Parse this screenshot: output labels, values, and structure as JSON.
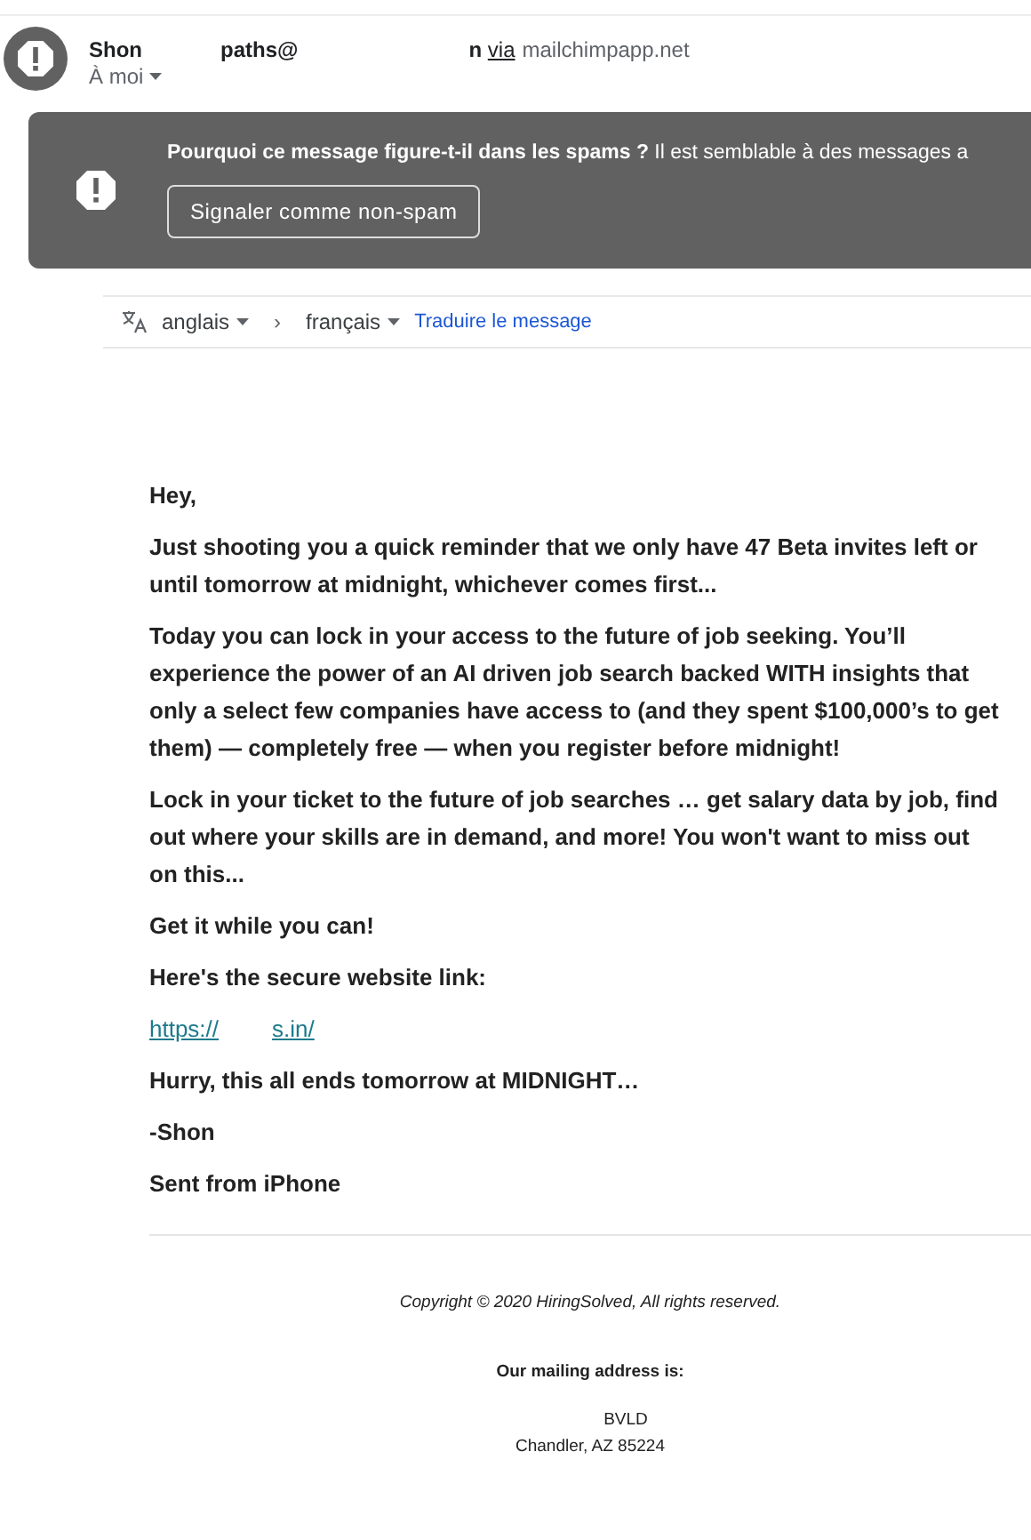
{
  "sender": {
    "name": "Shon",
    "address_part": "paths@",
    "address_end": "n",
    "via": "via",
    "domain": "mailchimpapp.net",
    "recipient": "À moi"
  },
  "spam_banner": {
    "question": "Pourquoi ce message figure-t-il dans les spams ?",
    "explanation": "Il est semblable à des messages a",
    "button": "Signaler comme non-spam"
  },
  "translate_bar": {
    "from": "anglais",
    "arrow": "›",
    "to": "français",
    "action": "Traduire le message"
  },
  "body": [
    {
      "kind": "text",
      "text": "Hey,"
    },
    {
      "kind": "text",
      "text": "Just shooting you a quick reminder that we only have 47 Beta invites left or until tomorrow at midnight, whichever comes first..."
    },
    {
      "kind": "text",
      "text": "Today you can lock in your access to the future of job seeking. You’ll experience the power of an AI driven job search backed WITH insights that only a select few companies have access to (and they spent $100,000’s to get them) — completely free — when you register before midnight!"
    },
    {
      "kind": "text",
      "text": "Lock in your ticket to the future of job searches … get salary data by job, find out where your skills are in demand, and more! You won't want to miss out on this..."
    },
    {
      "kind": "text",
      "text": "Get it while you can!"
    },
    {
      "kind": "text",
      "text": "Here's the secure website link:"
    },
    {
      "kind": "link",
      "start": "https://",
      "end": "s.in/"
    },
    {
      "kind": "text",
      "text": "Hurry, this all ends tomorrow at MIDNIGHT…"
    },
    {
      "kind": "text",
      "text": "-Shon"
    },
    {
      "kind": "text",
      "text": "Sent from iPhone"
    }
  ],
  "footer": {
    "copyright": "Copyright © 2020 HiringSolved, All rights reserved.",
    "mailing_heading": "Our mailing address is:",
    "address_lines": [
      "BVLD",
      "Chandler, AZ 85224"
    ]
  }
}
